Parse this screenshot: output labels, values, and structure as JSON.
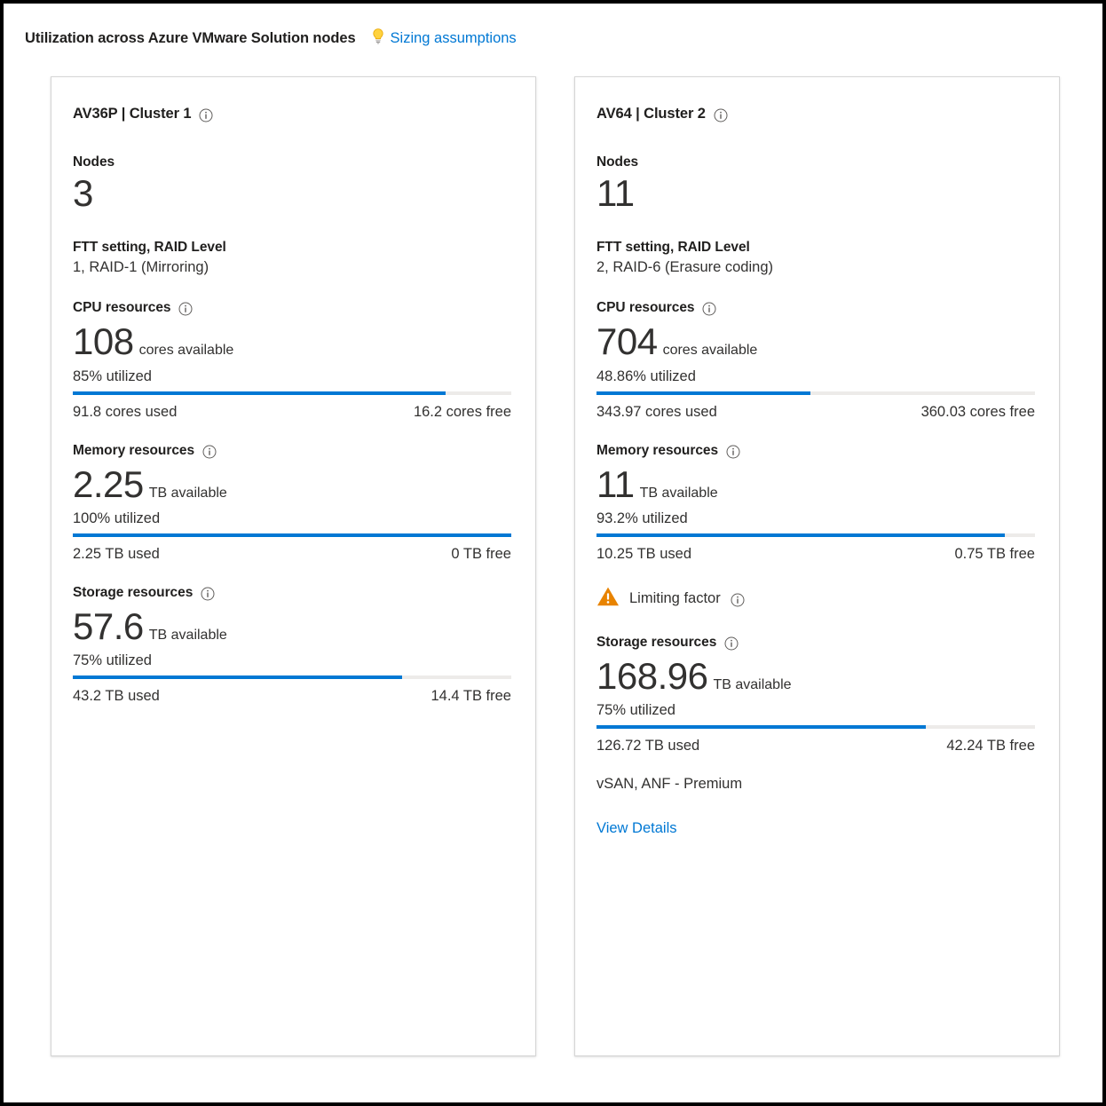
{
  "header": {
    "title": "Utilization across Azure VMware Solution nodes",
    "assumptions_link": "Sizing assumptions",
    "bulb_icon": "lightbulb-icon"
  },
  "colors": {
    "accent": "#0078d4",
    "bar_track": "#edebe9",
    "warning": "#e88300",
    "text": "#323130",
    "heading": "#201f1e",
    "card_border": "#d6d6d6"
  },
  "cards": [
    {
      "title": "AV36P | Cluster 1",
      "info_icon": "info-icon",
      "nodes_label": "Nodes",
      "nodes_value": "3",
      "ftt_label": "FTT setting, RAID Level",
      "ftt_value": "1, RAID-1 (Mirroring)",
      "cpu": {
        "label": "CPU resources",
        "value": "108",
        "unit": "cores available",
        "utilized": "85% utilized",
        "percent": 85,
        "used": "91.8 cores used",
        "free": "16.2 cores free"
      },
      "memory": {
        "label": "Memory resources",
        "value": "2.25",
        "unit": "TB available",
        "utilized": "100% utilized",
        "percent": 100,
        "used": "2.25 TB used",
        "free": "0 TB free"
      },
      "limiting": null,
      "storage": {
        "label": "Storage resources",
        "value": "57.6",
        "unit": "TB available",
        "utilized": "75% utilized",
        "percent": 75,
        "used": "43.2 TB used",
        "free": "14.4 TB free"
      },
      "storage_note": null,
      "view_details": null
    },
    {
      "title": "AV64 | Cluster 2",
      "info_icon": "info-icon",
      "nodes_label": "Nodes",
      "nodes_value": "11",
      "ftt_label": "FTT setting, RAID Level",
      "ftt_value": "2, RAID-6 (Erasure coding)",
      "cpu": {
        "label": "CPU resources",
        "value": "704",
        "unit": "cores available",
        "utilized": "48.86% utilized",
        "percent": 48.86,
        "used": "343.97 cores used",
        "free": "360.03 cores free"
      },
      "memory": {
        "label": "Memory resources",
        "value": "11",
        "unit": "TB available",
        "utilized": "93.2% utilized",
        "percent": 93.2,
        "used": "10.25 TB used",
        "free": "0.75 TB free"
      },
      "limiting": {
        "text": "Limiting factor",
        "warn_icon": "warning-triangle-icon",
        "info_icon": "info-icon"
      },
      "storage": {
        "label": "Storage resources",
        "value": "168.96",
        "unit": "TB available",
        "utilized": "75% utilized",
        "percent": 75,
        "used": "126.72 TB used",
        "free": "42.24 TB free"
      },
      "storage_note": "vSAN, ANF - Premium",
      "view_details": "View Details"
    }
  ]
}
